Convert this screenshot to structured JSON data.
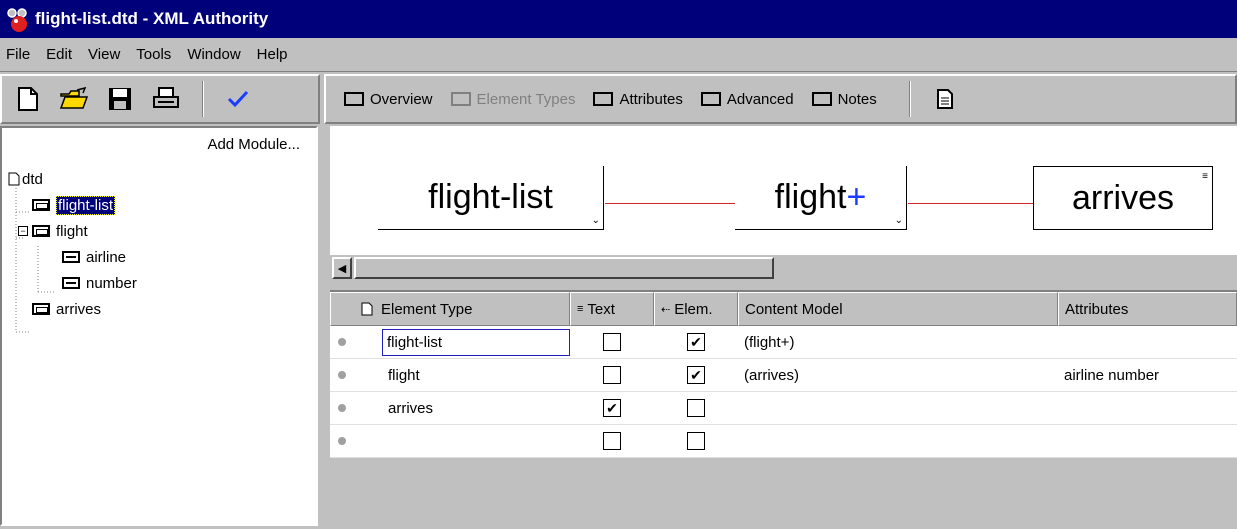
{
  "window": {
    "title": "flight-list.dtd - XML Authority"
  },
  "menu": [
    "File",
    "Edit",
    "View",
    "Tools",
    "Window",
    "Help"
  ],
  "tabs": [
    {
      "label": "Overview",
      "enabled": true
    },
    {
      "label": "Element Types",
      "enabled": false
    },
    {
      "label": "Attributes",
      "enabled": true
    },
    {
      "label": "Advanced",
      "enabled": true
    },
    {
      "label": "Notes",
      "enabled": true
    }
  ],
  "tree": {
    "add_module": "Add Module...",
    "root": "dtd",
    "nodes": [
      {
        "label": "flight-list",
        "type": "element",
        "selected": true
      },
      {
        "label": "flight",
        "type": "element"
      },
      {
        "label": "airline",
        "type": "attribute"
      },
      {
        "label": "number",
        "type": "attribute"
      },
      {
        "label": "arrives",
        "type": "element"
      }
    ]
  },
  "diagram": {
    "nodes": [
      {
        "label": "flight-list",
        "suffix": ""
      },
      {
        "label": "flight",
        "suffix": "+"
      },
      {
        "label": "arrives",
        "suffix": ""
      }
    ],
    "connector_color": "#d8232a"
  },
  "grid": {
    "headers": [
      "Element Type",
      "Text",
      "Elem.",
      "Content Model",
      "Attributes"
    ],
    "rows": [
      {
        "name": "flight-list",
        "text": false,
        "elem": true,
        "model": "(flight+)",
        "attributes": ""
      },
      {
        "name": "flight",
        "text": false,
        "elem": true,
        "model": "(arrives)",
        "attributes": "airline number"
      },
      {
        "name": "arrives",
        "text": true,
        "elem": false,
        "model": "",
        "attributes": ""
      },
      {
        "name": "",
        "text": false,
        "elem": false,
        "model": "",
        "attributes": ""
      }
    ]
  },
  "colors": {
    "titlebar": "#00007b",
    "selection": "#00007b",
    "accent_plus": "#1a3cff"
  }
}
